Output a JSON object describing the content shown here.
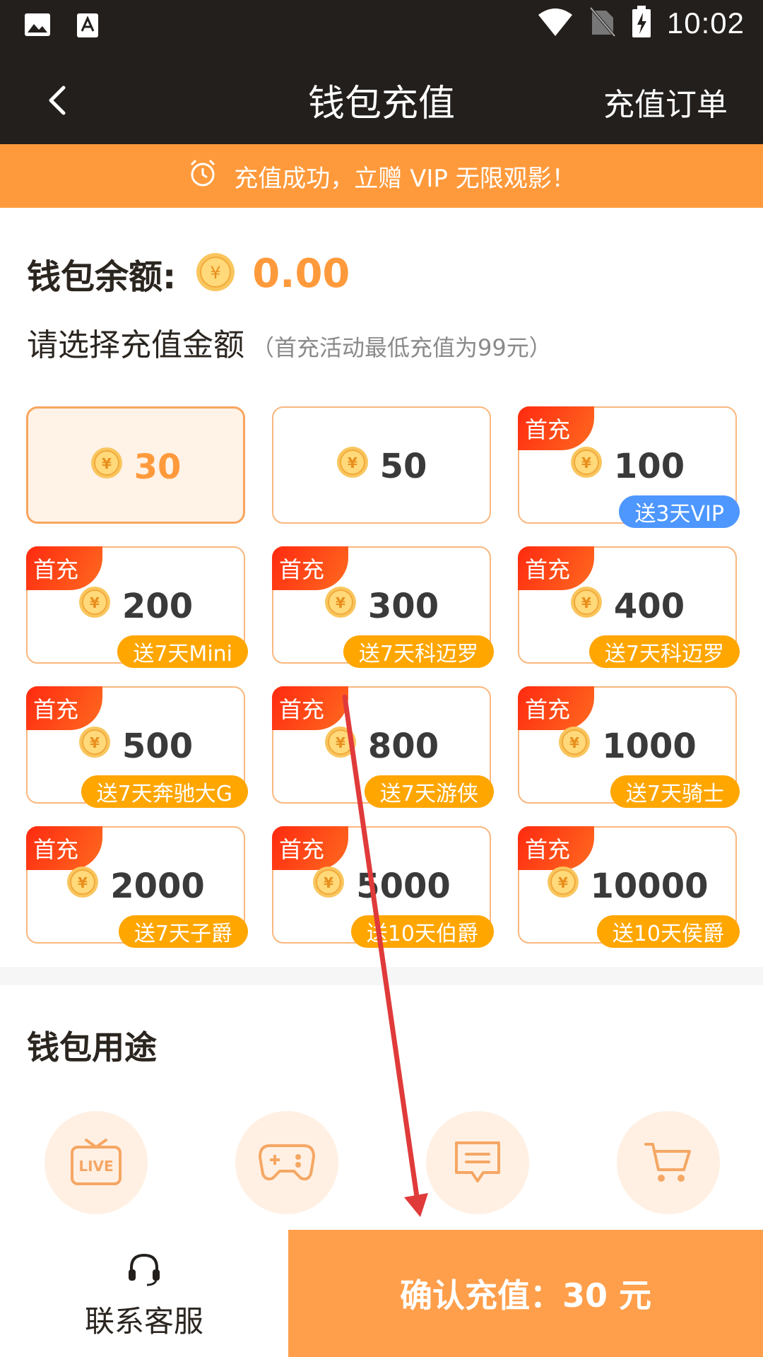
{
  "status_bar": {
    "time": "10:02"
  },
  "nav": {
    "title": "钱包充值",
    "orders_label": "充值订单"
  },
  "banner": {
    "text": "充值成功，立赠 VIP 无限观影！"
  },
  "balance": {
    "label": "钱包余额:",
    "value": "0.00"
  },
  "select": {
    "label": "请选择充值金额",
    "note": "（首充活动最低充值为99元）"
  },
  "first_label": "首充",
  "options": [
    {
      "amount": "30",
      "selected": true,
      "first": "",
      "gift": ""
    },
    {
      "amount": "50",
      "selected": false,
      "first": "",
      "gift": ""
    },
    {
      "amount": "100",
      "selected": false,
      "first": "首充",
      "gift": "送3天VIP"
    },
    {
      "amount": "200",
      "selected": false,
      "first": "首充",
      "gift": "送7天Mini"
    },
    {
      "amount": "300",
      "selected": false,
      "first": "首充",
      "gift": "送7天科迈罗"
    },
    {
      "amount": "400",
      "selected": false,
      "first": "首充",
      "gift": "送7天科迈罗"
    },
    {
      "amount": "500",
      "selected": false,
      "first": "首充",
      "gift": "送7天奔驰大G"
    },
    {
      "amount": "800",
      "selected": false,
      "first": "首充",
      "gift": "送7天游侠"
    },
    {
      "amount": "1000",
      "selected": false,
      "first": "首充",
      "gift": "送7天骑士"
    },
    {
      "amount": "2000",
      "selected": false,
      "first": "首充",
      "gift": "送7天子爵"
    },
    {
      "amount": "5000",
      "selected": false,
      "first": "首充",
      "gift": "送10天伯爵"
    },
    {
      "amount": "10000",
      "selected": false,
      "first": "首充",
      "gift": "送10天侯爵"
    }
  ],
  "usage": {
    "title": "钱包用途",
    "items": [
      {
        "icon": "live-tv-icon"
      },
      {
        "icon": "gamepad-icon"
      },
      {
        "icon": "chat-icon"
      },
      {
        "icon": "cart-icon"
      }
    ]
  },
  "bottom": {
    "service_label": "联系客服",
    "confirm_label": "确认充值：30 元"
  },
  "colors": {
    "accent": "#ff9a3c",
    "dark": "#231f1c",
    "gift": "#ffa600",
    "first_badge": "#ff3a12",
    "vip_badge": "#4d97ff"
  }
}
